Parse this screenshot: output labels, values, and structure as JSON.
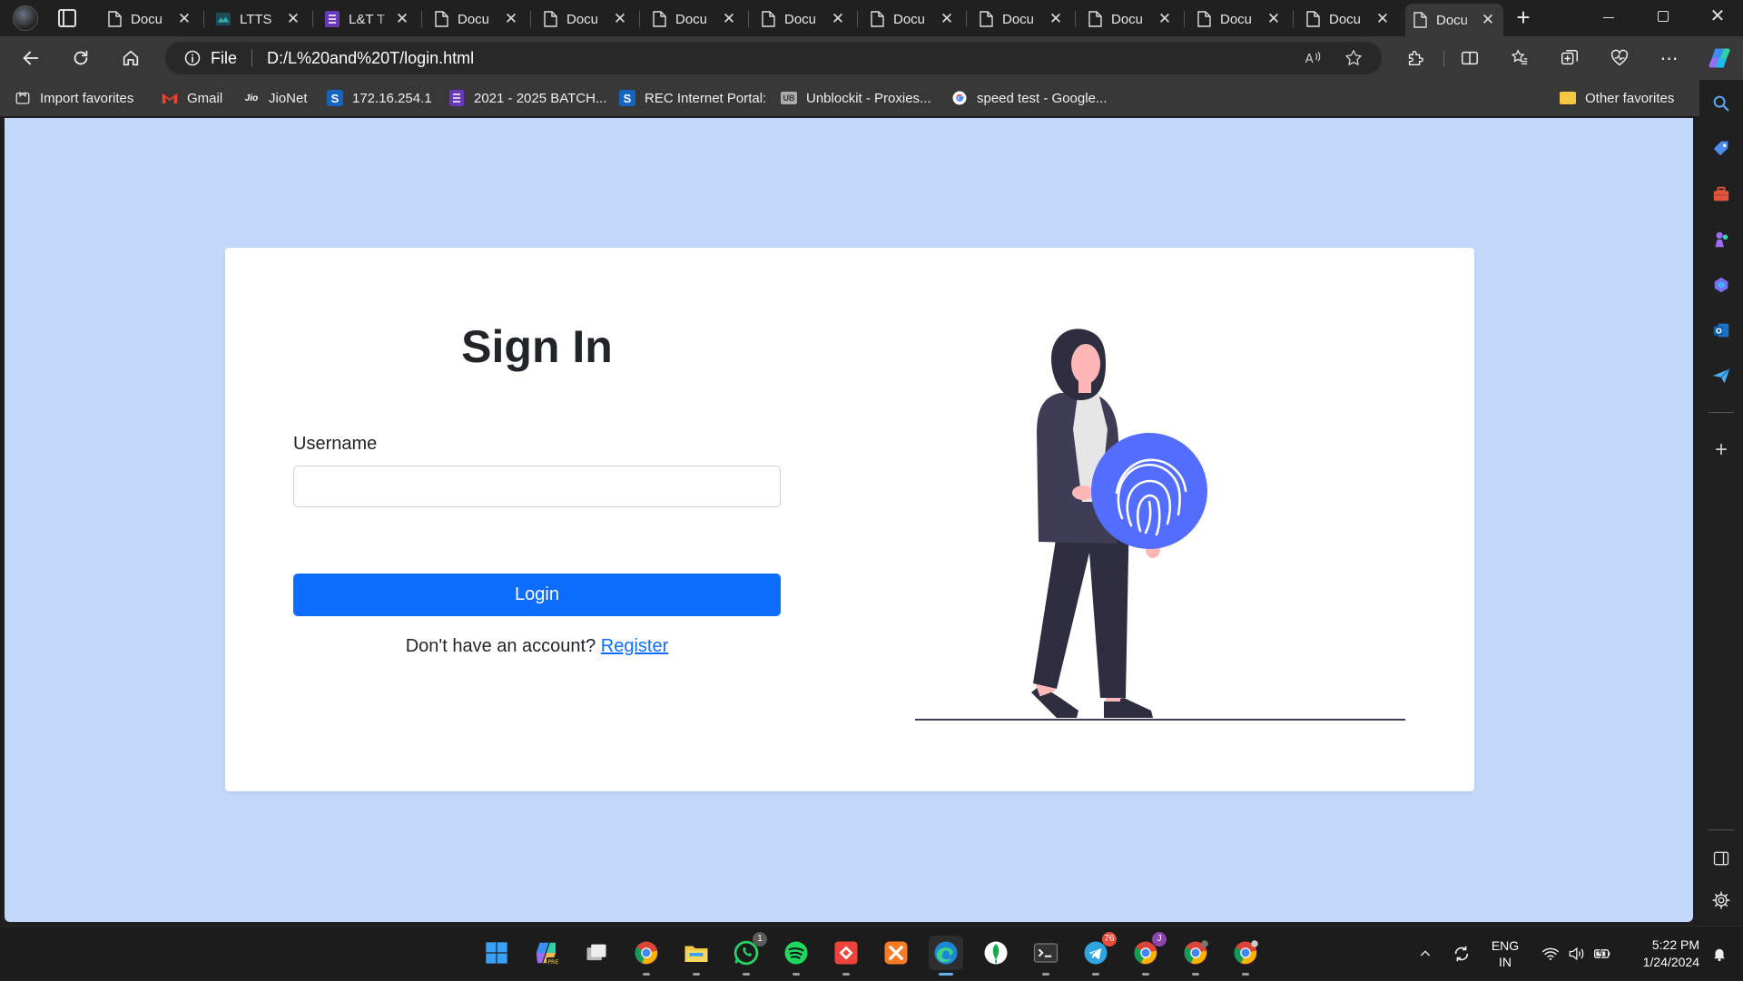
{
  "tabs": [
    {
      "label": "Docu",
      "icon": "document-icon"
    },
    {
      "label": "LTTS",
      "icon": "ltts-icon"
    },
    {
      "label": "L&T T",
      "icon": "form-icon"
    },
    {
      "label": "Docu",
      "icon": "document-icon"
    },
    {
      "label": "Docu",
      "icon": "document-icon"
    },
    {
      "label": "Docu",
      "icon": "document-icon"
    },
    {
      "label": "Docu",
      "icon": "document-icon"
    },
    {
      "label": "Docu",
      "icon": "document-icon"
    },
    {
      "label": "Docu",
      "icon": "document-icon"
    },
    {
      "label": "Docu",
      "icon": "document-icon"
    },
    {
      "label": "Docu",
      "icon": "document-icon"
    },
    {
      "label": "Docu",
      "icon": "document-icon"
    },
    {
      "label": "Docu",
      "icon": "document-icon",
      "active": true
    }
  ],
  "address": {
    "scheme_label": "File",
    "url": "D:/L%20and%20T/login.html"
  },
  "favorites": {
    "items": [
      {
        "label": "Import favorites",
        "icon": "import-icon"
      },
      {
        "label": "Gmail",
        "icon": "gmail-icon"
      },
      {
        "label": "JioNet",
        "icon": "jio-icon"
      },
      {
        "label": "172.16.254.1",
        "icon": "s-icon"
      },
      {
        "label": "2021 - 2025 BATCH...",
        "icon": "form-icon"
      },
      {
        "label": "REC Internet Portal:",
        "icon": "s-icon"
      },
      {
        "label": "Unblockit - Proxies...",
        "icon": "ub-icon"
      },
      {
        "label": "speed test - Google...",
        "icon": "google-icon"
      }
    ],
    "other_label": "Other favorites"
  },
  "login": {
    "title": "Sign In",
    "username_label": "Username",
    "username_value": "",
    "login_button": "Login",
    "register_prompt": "Don't have an account?",
    "register_link": "Register"
  },
  "taskbar": {
    "whatsapp_badge": "1",
    "telegram_badge": "76",
    "chrome_profile_badge": "J",
    "language": "ENG",
    "region": "IN",
    "time": "5:22 PM",
    "date": "1/24/2024"
  },
  "colors": {
    "page_background": "#c2d9fb",
    "primary": "#0d6efd",
    "illustration_accent": "#536dfe"
  }
}
